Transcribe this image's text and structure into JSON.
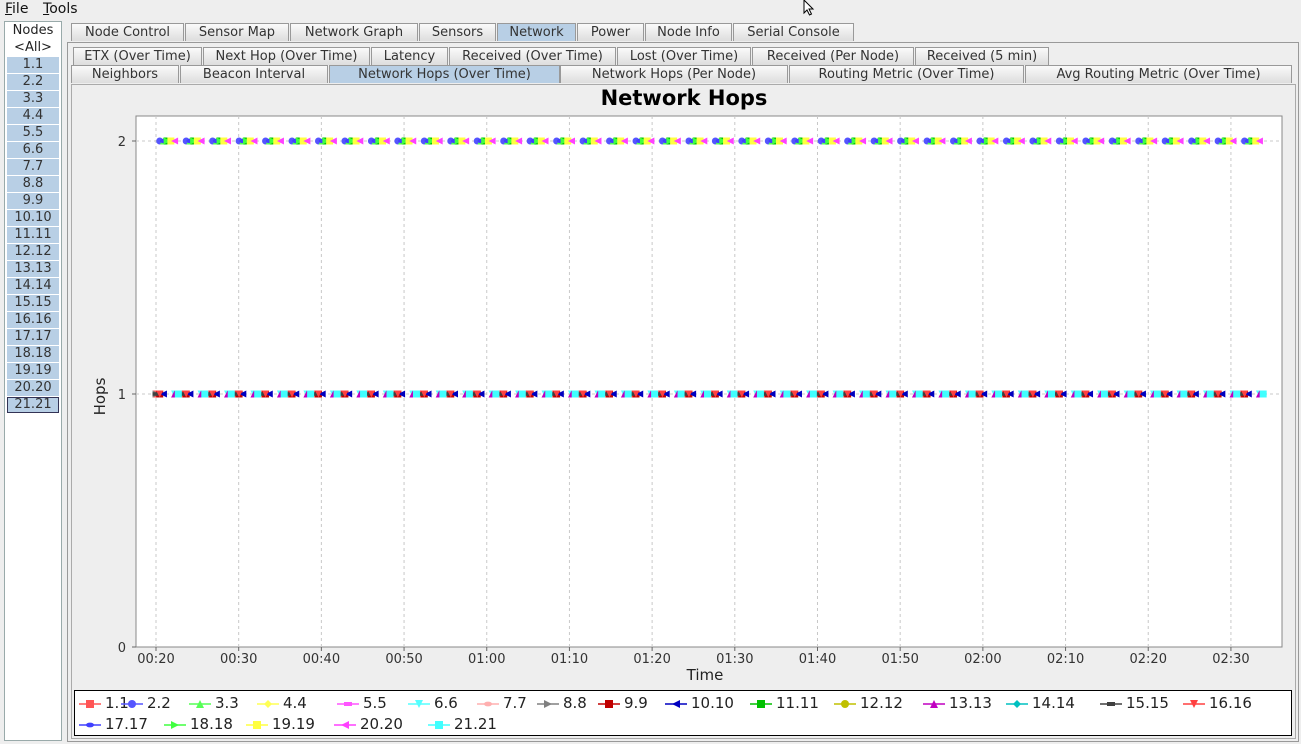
{
  "menu": [
    {
      "label": "File",
      "accel": "F",
      "rest": "ile"
    },
    {
      "label": "Tools",
      "accel": "T",
      "rest": "ools"
    }
  ],
  "nodes": {
    "title": "Nodes",
    "items": [
      "<All>",
      "1.1",
      "2.2",
      "3.3",
      "4.4",
      "5.5",
      "6.6",
      "7.7",
      "8.8",
      "9.9",
      "10.10",
      "11.11",
      "12.12",
      "13.13",
      "14.14",
      "15.15",
      "16.16",
      "17.17",
      "18.18",
      "19.19",
      "20.20",
      "21.21"
    ],
    "selected": "21.21"
  },
  "main_tabs": [
    "Node Control",
    "Sensor Map",
    "Network Graph",
    "Sensors",
    "Network",
    "Power",
    "Node Info",
    "Serial Console"
  ],
  "main_tab_active": "Network",
  "sub_tabs_row1": [
    "ETX (Over Time)",
    "Next Hop (Over Time)",
    "Latency",
    "Received (Over Time)",
    "Lost (Over Time)",
    "Received (Per Node)",
    "Received (5 min)"
  ],
  "sub_tabs_row2": [
    "Neighbors",
    "Beacon Interval",
    "Network Hops (Over Time)",
    "Network Hops (Per Node)",
    "Routing Metric (Over Time)",
    "Avg Routing Metric (Over Time)"
  ],
  "sub_tab_active": "Network Hops (Over Time)",
  "chart_data": {
    "type": "scatter",
    "title": "Network Hops",
    "xlabel": "Time",
    "ylabel": "Hops",
    "ylim": [
      0,
      2
    ],
    "yticks": [
      0,
      1,
      2
    ],
    "xlim": [
      "00:20",
      "02:34"
    ],
    "xticks": [
      "00:20",
      "00:30",
      "00:40",
      "00:50",
      "01:00",
      "01:10",
      "01:20",
      "01:30",
      "01:40",
      "01:50",
      "02:00",
      "02:10",
      "02:20",
      "02:30"
    ],
    "grid": true,
    "legend_position": "bottom",
    "series": [
      {
        "name": "1.1",
        "color": "#ff5555",
        "marker": "square",
        "hops": 1
      },
      {
        "name": "2.2",
        "color": "#5555ff",
        "marker": "circle",
        "hops": 2
      },
      {
        "name": "3.3",
        "color": "#55ff55",
        "marker": "triangle-up",
        "hops": 2
      },
      {
        "name": "4.4",
        "color": "#ffff55",
        "marker": "diamond",
        "hops": 2
      },
      {
        "name": "5.5",
        "color": "#ff55ff",
        "marker": "rect-h",
        "hops": 2
      },
      {
        "name": "6.6",
        "color": "#55ffff",
        "marker": "triangle-down",
        "hops": 1
      },
      {
        "name": "7.7",
        "color": "#ffafaf",
        "marker": "ellipse",
        "hops": 1
      },
      {
        "name": "8.8",
        "color": "#808080",
        "marker": "triangle-right",
        "hops": 1
      },
      {
        "name": "9.9",
        "color": "#c00000",
        "marker": "square",
        "hops": 1
      },
      {
        "name": "10.10",
        "color": "#0000c0",
        "marker": "triangle-left",
        "hops": 1
      },
      {
        "name": "11.11",
        "color": "#00c000",
        "marker": "square",
        "hops": 2
      },
      {
        "name": "12.12",
        "color": "#c0c000",
        "marker": "circle",
        "hops": 2
      },
      {
        "name": "13.13",
        "color": "#c000c0",
        "marker": "triangle-up",
        "hops": 1
      },
      {
        "name": "14.14",
        "color": "#00c0c0",
        "marker": "diamond",
        "hops": 1
      },
      {
        "name": "15.15",
        "color": "#404040",
        "marker": "rect-h",
        "hops": 1
      },
      {
        "name": "16.16",
        "color": "#ff4040",
        "marker": "triangle-down",
        "hops": 1
      },
      {
        "name": "17.17",
        "color": "#4040ff",
        "marker": "ellipse",
        "hops": 2
      },
      {
        "name": "18.18",
        "color": "#40ff40",
        "marker": "triangle-right",
        "hops": 2
      },
      {
        "name": "19.19",
        "color": "#ffff40",
        "marker": "square",
        "hops": 2
      },
      {
        "name": "20.20",
        "color": "#ff40ff",
        "marker": "triangle-left",
        "hops": 2
      },
      {
        "name": "21.21",
        "color": "#40ffff",
        "marker": "square",
        "hops": 1
      }
    ]
  }
}
